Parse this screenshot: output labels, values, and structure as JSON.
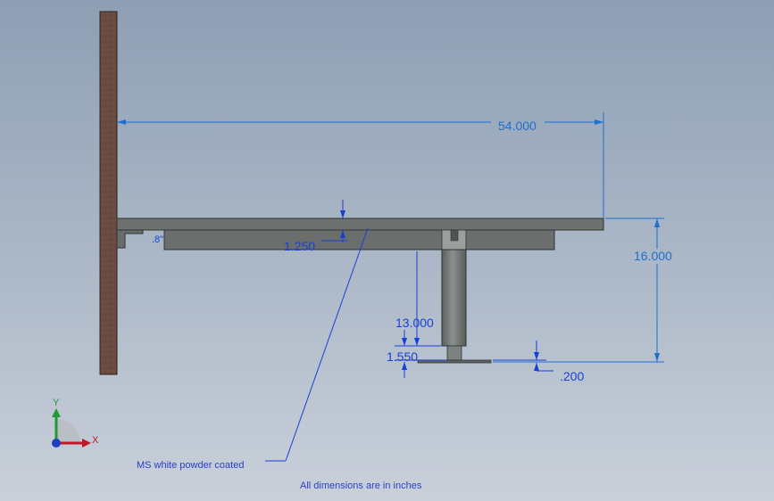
{
  "dimensions": {
    "overall_length": "54.000",
    "overall_height": "16.000",
    "plate_thickness": "1.250",
    "column_height": "13.000",
    "foot_height": "1.550",
    "base_plate_thickness": ".200",
    "bracket_fraction": ".8\""
  },
  "notes": {
    "material": "MS  white powder coated",
    "units": "All dimensions are in inches"
  },
  "triad": {
    "x_label": "X",
    "y_label": "Y"
  },
  "colors": {
    "wall": "#6b4a42",
    "steel": "#6d7271",
    "dimension": "#1a3fd6",
    "x_axis": "#c0182a",
    "y_axis": "#1f9a35",
    "z_axis": "#1f3fbf"
  }
}
